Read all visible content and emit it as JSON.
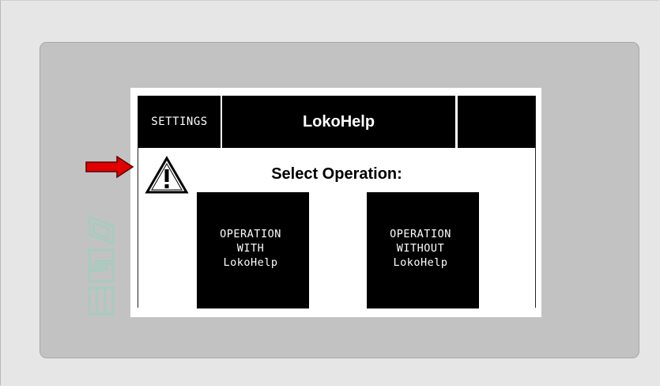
{
  "header": {
    "settings_label": "SETTINGS",
    "title": "LokoHelp"
  },
  "main": {
    "prompt": "Select Operation:",
    "buttons": [
      {
        "lines": [
          "OPERATION",
          "WITH",
          "LokoHelp"
        ]
      },
      {
        "lines": [
          "OPERATION",
          "WITHOUT",
          "LokoHelp"
        ]
      }
    ]
  },
  "icons": {
    "warning": "warning-triangle-icon",
    "arrow": "red-arrow-right-icon",
    "logo": "vertical-device-logo"
  },
  "colors": {
    "background": "#e6e6e6",
    "panel": "#c2c2c2",
    "screen": "#ffffff",
    "header": "#000000",
    "arrow": "#e00000",
    "logo": "#a8cbbf"
  }
}
